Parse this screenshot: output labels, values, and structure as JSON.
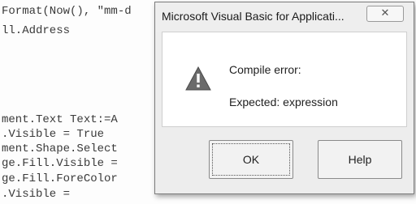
{
  "code_editor": {
    "lines": [
      "Format(Now(), \"mm-d",
      "ll.Address",
      "",
      "",
      "",
      "ment.Text Text:=A",
      ".Visible = True",
      "ment.Shape.Select",
      "ge.Fill.Visible =",
      "ge.Fill.ForeColor",
      ".Visible ="
    ]
  },
  "dialog": {
    "title": "Microsoft Visual Basic for Applicati...",
    "close_glyph": "✕",
    "icon": "warning-icon",
    "message_title": "Compile error:",
    "message_detail": "Expected: expression",
    "buttons": {
      "ok": "OK",
      "help": "Help"
    }
  },
  "colors": {
    "warning_icon": "#6b6b6b",
    "dialog_background": "#ededed",
    "content_background": "#ffffff"
  }
}
